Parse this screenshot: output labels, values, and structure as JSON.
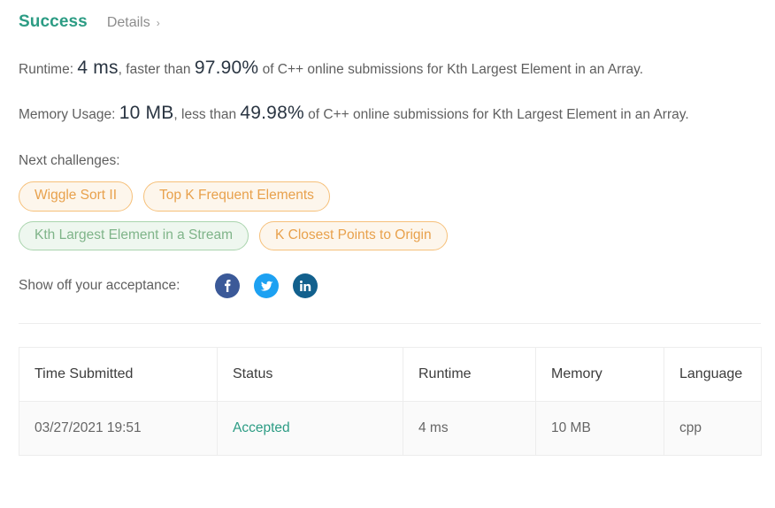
{
  "header": {
    "status": "Success",
    "details_label": "Details",
    "chevron": "›",
    "status_color": "#2c9c84"
  },
  "stats": {
    "runtime": {
      "prefix": "Runtime:",
      "value": "4 ms",
      "mid": ", faster than",
      "percent": "97.90%",
      "suffix": "of C++ online submissions for Kth Largest Element in an Array."
    },
    "memory": {
      "prefix": "Memory Usage:",
      "value": "10 MB",
      "mid": ", less than",
      "percent": "49.98%",
      "suffix": "of C++ online submissions for Kth Largest Element in an Array."
    }
  },
  "next_challenges": {
    "label": "Next challenges:",
    "tags": [
      {
        "label": "Wiggle Sort II",
        "style": "orange"
      },
      {
        "label": "Top K Frequent Elements",
        "style": "orange"
      },
      {
        "label": "Kth Largest Element in a Stream",
        "style": "green"
      },
      {
        "label": "K Closest Points to Origin",
        "style": "orange"
      }
    ]
  },
  "share": {
    "label": "Show off your acceptance:",
    "buttons": [
      {
        "name": "facebook-icon",
        "color": "#3b5998"
      },
      {
        "name": "twitter-icon",
        "color": "#1da1f2"
      },
      {
        "name": "linkedin-icon",
        "color": "#12608d"
      }
    ]
  },
  "submissions": {
    "columns": [
      "Time Submitted",
      "Status",
      "Runtime",
      "Memory",
      "Language"
    ],
    "rows": [
      {
        "time": "03/27/2021 19:51",
        "status": "Accepted",
        "runtime": "4 ms",
        "memory": "10 MB",
        "language": "cpp"
      }
    ]
  }
}
